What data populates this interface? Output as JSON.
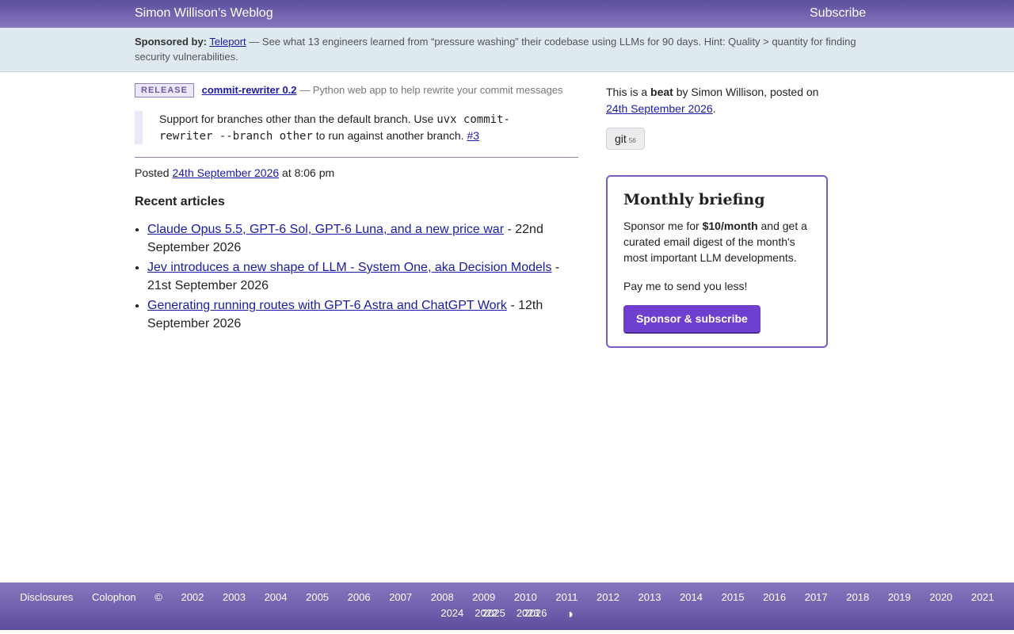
{
  "header": {
    "site_title": "Simon Willison’s Weblog",
    "subscribe_label": "Subscribe"
  },
  "sponsor": {
    "label": "Sponsored by:",
    "name": "Teleport",
    "text": "— See what 13 engineers learned from “pressure washing” their codebase using LLMs for 90 days. Hint: Quality > quantity for finding security vulnerabilities."
  },
  "entry": {
    "badge": "RELEASE",
    "release_title": "commit-rewriter 0.2",
    "release_desc": "— Python web app to help rewrite your commit messages",
    "quote_pre": "Support for branches other than the default branch. Use ",
    "quote_code": "uvx commit-rewriter --branch other",
    "quote_post": " to run against another branch. ",
    "quote_link": "#3",
    "posted_label": "Posted",
    "posted_date": "24th September 2026",
    "posted_time": "at 8:06 pm"
  },
  "recent": {
    "heading": "Recent articles",
    "items": [
      {
        "title": "Claude Opus 5.5, GPT-6 Sol, GPT-6 Luna, and a new price war",
        "date": "- 22nd September 2026"
      },
      {
        "title": "Jev introduces a new shape of LLM - System One, aka Decision Models",
        "date": "- 21st September 2026"
      },
      {
        "title": "Generating running routes with GPT-6 Astra and ChatGPT Work",
        "date": "- 12th September 2026"
      }
    ]
  },
  "sidebar": {
    "beat_pre": "This is a ",
    "beat_word": "beat",
    "beat_post": " by Simon Willison, posted on ",
    "beat_date": "24th September 2026",
    "beat_end": ".",
    "tag_name": "git",
    "tag_count": "56"
  },
  "briefing": {
    "title": "Monthly briefing",
    "text_pre": "Sponsor me for ",
    "price": "$10/month",
    "text_post": " and get a curated email digest of the month's most important LLM developments.",
    "pay_text": "Pay me to send you less!",
    "button_label": "Sponsor & subscribe"
  },
  "footer": {
    "links": [
      "Disclosures",
      "Colophon",
      "©"
    ],
    "years_row1": [
      "2002",
      "2003",
      "2004",
      "2005",
      "2006",
      "2007",
      "2008",
      "2009",
      "2010",
      "2011",
      "2012",
      "2013",
      "2014",
      "2015",
      "2016",
      "2017",
      "2018",
      "2019",
      "2020",
      "2021",
      "2022",
      "2023"
    ],
    "years_row2": [
      "2024",
      "2025",
      "2026"
    ],
    "contrast_icon": "◑"
  },
  "colors": {
    "header_purple": "#5d4e9e",
    "accent_purple": "#6f3fd0",
    "sponsor_bg": "#dfe9f0",
    "link_blue": "#1a1aa6"
  }
}
